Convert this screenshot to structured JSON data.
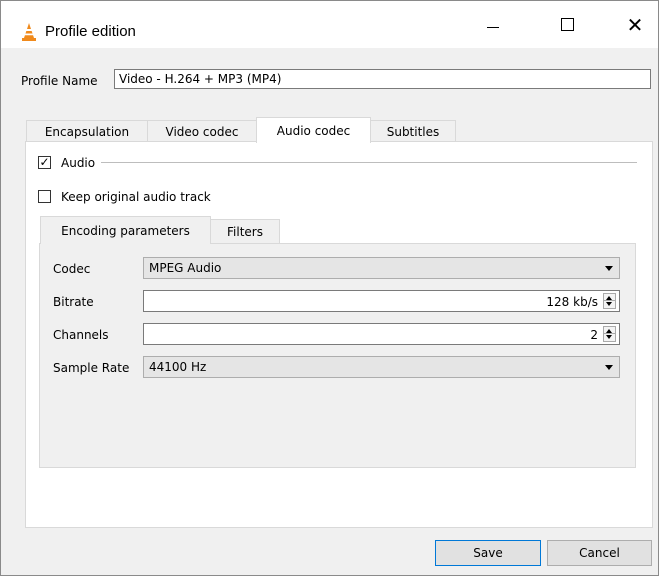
{
  "window": {
    "title": "Profile edition",
    "icon": "vlc-cone-icon"
  },
  "profile": {
    "label": "Profile Name",
    "value": "Video - H.264 + MP3 (MP4)"
  },
  "tabs": [
    {
      "label": "Encapsulation",
      "active": false
    },
    {
      "label": "Video codec",
      "active": false
    },
    {
      "label": "Audio codec",
      "active": true
    },
    {
      "label": "Subtitles",
      "active": false
    }
  ],
  "audio": {
    "enabled_label": "Audio",
    "enabled": true,
    "keep_original_label": "Keep original audio track",
    "keep_original": false
  },
  "subtabs": [
    {
      "label": "Encoding parameters",
      "active": true
    },
    {
      "label": "Filters",
      "active": false
    }
  ],
  "encoding": {
    "codec": {
      "label": "Codec",
      "value": "MPEG Audio"
    },
    "bitrate": {
      "label": "Bitrate",
      "value": "128 kb/s"
    },
    "channels": {
      "label": "Channels",
      "value": "2"
    },
    "sample_rate": {
      "label": "Sample Rate",
      "value": "44100 Hz"
    }
  },
  "buttons": {
    "save": "Save",
    "cancel": "Cancel"
  },
  "colors": {
    "accent": "#0078d7",
    "vlc_orange": "#f08a1c"
  }
}
